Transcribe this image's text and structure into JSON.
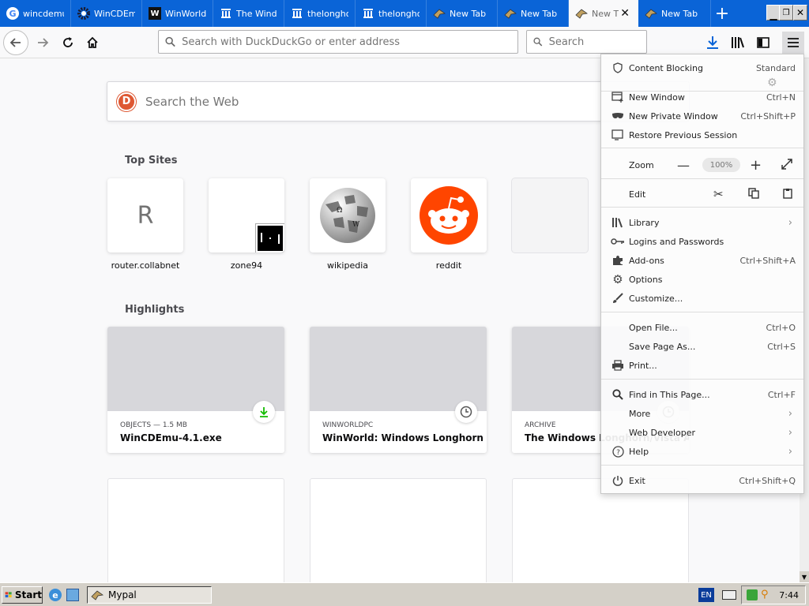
{
  "tabs": [
    {
      "label": "wincdemu",
      "icon": "google-icon"
    },
    {
      "label": "WinCDEmu",
      "icon": "gear-icon"
    },
    {
      "label": "WinWorld",
      "icon": "winworld-icon"
    },
    {
      "label": "The Windo",
      "icon": "archive-icon"
    },
    {
      "label": "thelongho",
      "icon": "archive-icon"
    },
    {
      "label": "thelongho",
      "icon": "archive-icon"
    },
    {
      "label": "New Tab",
      "icon": "mypal-icon"
    },
    {
      "label": "New Tab",
      "icon": "mypal-icon"
    },
    {
      "label": "New T",
      "icon": "mypal-icon"
    },
    {
      "label": "New Tab",
      "icon": "mypal-icon"
    }
  ],
  "toolbar": {
    "url_placeholder": "Search with DuckDuckGo or enter address",
    "search_placeholder": "Search"
  },
  "page": {
    "websearch_placeholder": "Search the Web",
    "top_sites_title": "Top Sites",
    "highlights_title": "Highlights",
    "top_sites": [
      {
        "label": "router.collabnet",
        "letter": "R"
      },
      {
        "label": "zone94"
      },
      {
        "label": "wikipedia"
      },
      {
        "label": "reddit"
      }
    ],
    "highlights": [
      {
        "meta": "OBJECTS — 1.5 MB",
        "title": "WinCDEmu-4.1.exe",
        "badge": "download-icon"
      },
      {
        "meta": "WINWORLDPC",
        "title": "WinWorld: Windows Longhorn P...",
        "badge": "clock-icon"
      },
      {
        "meta": "ARCHIVE",
        "title": "The Windows Longhorn/Vista Ar...",
        "badge": "clock-icon"
      }
    ]
  },
  "menu": {
    "content_blocking": {
      "label": "Content Blocking",
      "value": "Standard"
    },
    "new_window": {
      "label": "New Window",
      "shortcut": "Ctrl+N"
    },
    "new_private": {
      "label": "New Private Window",
      "shortcut": "Ctrl+Shift+P"
    },
    "restore": {
      "label": "Restore Previous Session"
    },
    "zoom": {
      "label": "Zoom",
      "value": "100%"
    },
    "edit": {
      "label": "Edit"
    },
    "library": {
      "label": "Library"
    },
    "logins": {
      "label": "Logins and Passwords"
    },
    "addons": {
      "label": "Add-ons",
      "shortcut": "Ctrl+Shift+A"
    },
    "options": {
      "label": "Options"
    },
    "customize": {
      "label": "Customize..."
    },
    "open_file": {
      "label": "Open File...",
      "shortcut": "Ctrl+O"
    },
    "save_page": {
      "label": "Save Page As...",
      "shortcut": "Ctrl+S"
    },
    "print": {
      "label": "Print..."
    },
    "find": {
      "label": "Find in This Page...",
      "shortcut": "Ctrl+F"
    },
    "more": {
      "label": "More"
    },
    "webdev": {
      "label": "Web Developer"
    },
    "help": {
      "label": "Help"
    },
    "exit": {
      "label": "Exit",
      "shortcut": "Ctrl+Shift+Q"
    }
  },
  "taskbar": {
    "start_label": "Start",
    "task_label": "Mypal",
    "lang": "EN",
    "clock": "7:44"
  },
  "colors": {
    "tabstrip": "#0a64d7",
    "reddit": "#ff4500",
    "ddg": "#de5833",
    "download_green": "#12bc00"
  }
}
